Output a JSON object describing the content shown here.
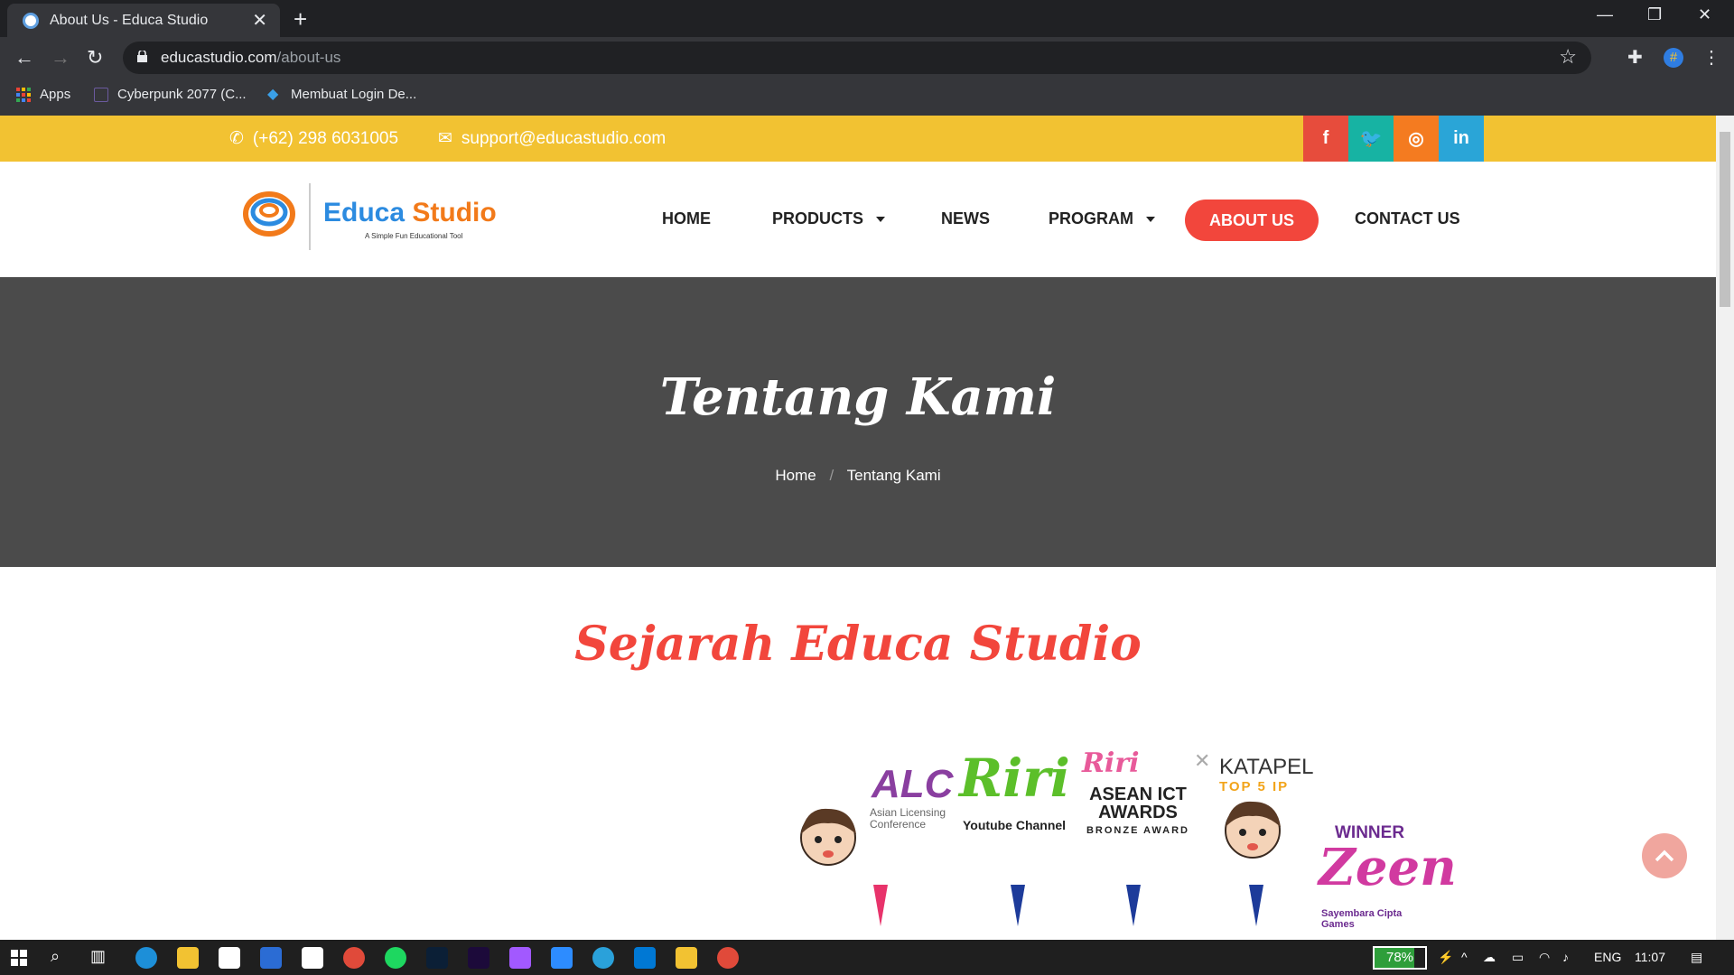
{
  "browser": {
    "tab_title": "About Us - Educa Studio",
    "url_domain": "educastudio.com",
    "url_path": "/about-us",
    "bookmarks": [
      "Apps",
      "Cyberpunk 2077 (C...",
      "Membuat Login De..."
    ]
  },
  "topbar": {
    "phone": "(+62) 298 6031005",
    "email": "support@educastudio.com",
    "social": [
      {
        "name": "facebook",
        "label": "f",
        "color": "#e74c3c"
      },
      {
        "name": "twitter",
        "label": "t",
        "color": "#17b3a3"
      },
      {
        "name": "instagram",
        "label": "◎",
        "color": "#f47b20"
      },
      {
        "name": "linkedin",
        "label": "in",
        "color": "#2aa5d7"
      }
    ]
  },
  "logo": {
    "word1": "Educa",
    "word2": "Studio",
    "tagline": "A Simple Fun Educational Tool"
  },
  "nav": {
    "home": "HOME",
    "products": "PRODUCTS",
    "news": "NEWS",
    "program": "PROGRAM",
    "about": "ABOUT US",
    "contact": "CONTACT US"
  },
  "hero": {
    "title": "Tentang Kami",
    "crumb_home": "Home",
    "crumb_current": "Tentang Kami"
  },
  "section": {
    "title": "Sejarah Educa Studio"
  },
  "timeline": {
    "alc": "ALC",
    "alc_sub": "Asian Licensing Conference",
    "riri": "Riri",
    "riri_sub": "Youtube Channel",
    "asean": "ASEAN ICT AWARDS",
    "asean_sub": "BRONZE AWARD",
    "katapel": "KATAPEL",
    "katapel_sub": "TOP 5 IP",
    "winner": "WINNER",
    "zeen": "Zeen",
    "zeen_sub": "Sayembara Cipta Games"
  },
  "taskbar": {
    "battery": "78%",
    "battery_level": 0.78,
    "lang": "ENG",
    "time": "11:07"
  },
  "colors": {
    "accent": "#f2463c",
    "topbar": "#f2c232",
    "hero": "#4b4b4b"
  }
}
